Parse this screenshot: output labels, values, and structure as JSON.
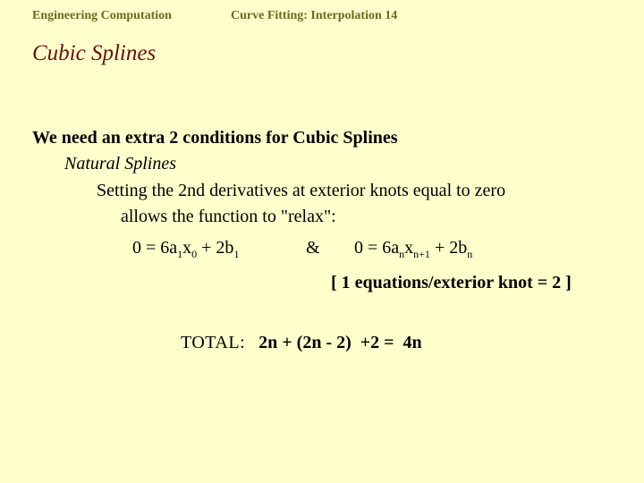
{
  "header": {
    "course": "Engineering Computation",
    "topic": "Curve Fitting: Interpolation 14"
  },
  "title": "Cubic Splines",
  "body": {
    "line1": "We need an extra 2 conditions for Cubic Splines",
    "line2": "Natural Splines",
    "line3": "Setting the 2nd derivatives at exterior knots equal to zero",
    "line4": "allows the function to \"relax\":"
  },
  "equations": {
    "left": {
      "lhs": "0 = 6a",
      "sub1": "1",
      "x": "x",
      "sub2": "0",
      "plus": " + 2b",
      "sub3": "1"
    },
    "connector": "&",
    "right": {
      "lhs": "0 = 6a",
      "sub1": "n",
      "x": "x",
      "sub2": "n+1",
      "plus": " + 2b",
      "sub3": "n"
    }
  },
  "note": "[ 1 equations/exterior knot = 2 ]",
  "total": {
    "label": "TOTAL:",
    "expression": "2n + (2n - 2)  +2 =  4n"
  },
  "colors": {
    "background": "#ffffcc",
    "header": "#6b6b1f",
    "title": "#6b0f0f",
    "text": "#000000"
  }
}
